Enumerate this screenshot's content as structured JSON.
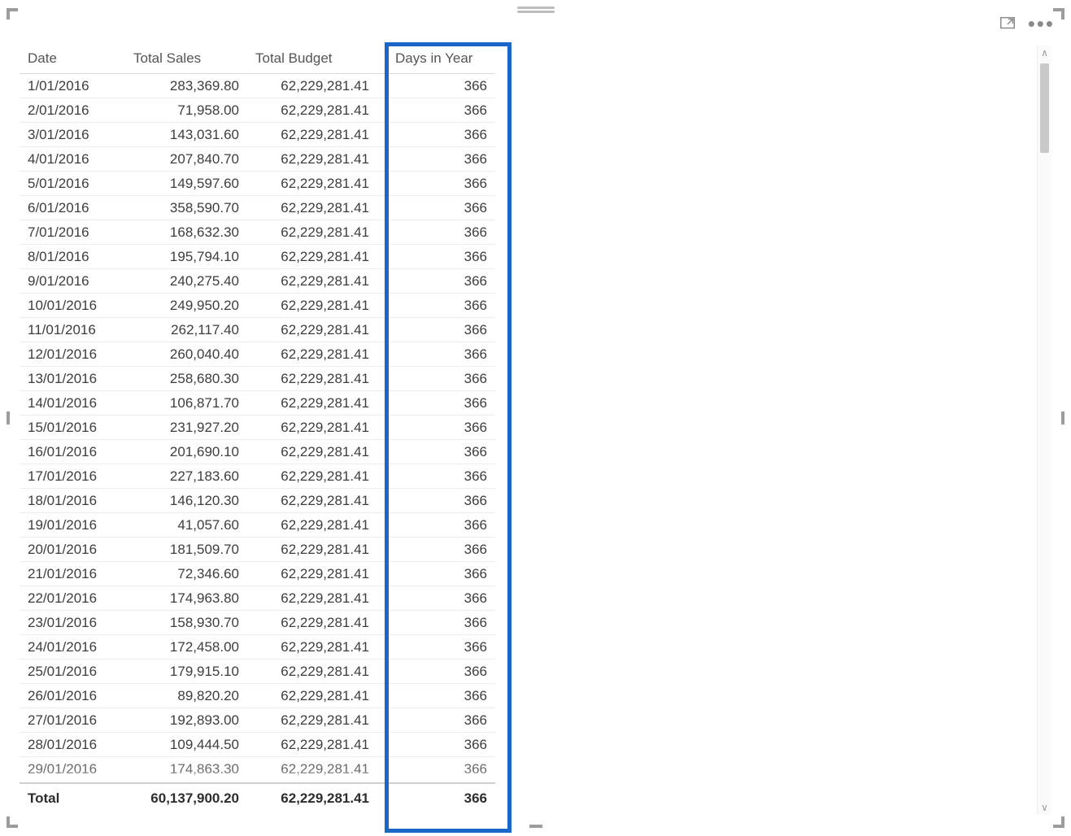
{
  "visual": {
    "focus_mode_tooltip": "Focus mode",
    "more_options_tooltip": "More options"
  },
  "table": {
    "headers": {
      "date": "Date",
      "total_sales": "Total Sales",
      "total_budget": "Total Budget",
      "days_in_year": "Days in Year"
    },
    "rows": [
      {
        "date": "1/01/2016",
        "total_sales": "283,369.80",
        "total_budget": "62,229,281.41",
        "days_in_year": "366"
      },
      {
        "date": "2/01/2016",
        "total_sales": "71,958.00",
        "total_budget": "62,229,281.41",
        "days_in_year": "366"
      },
      {
        "date": "3/01/2016",
        "total_sales": "143,031.60",
        "total_budget": "62,229,281.41",
        "days_in_year": "366"
      },
      {
        "date": "4/01/2016",
        "total_sales": "207,840.70",
        "total_budget": "62,229,281.41",
        "days_in_year": "366"
      },
      {
        "date": "5/01/2016",
        "total_sales": "149,597.60",
        "total_budget": "62,229,281.41",
        "days_in_year": "366"
      },
      {
        "date": "6/01/2016",
        "total_sales": "358,590.70",
        "total_budget": "62,229,281.41",
        "days_in_year": "366"
      },
      {
        "date": "7/01/2016",
        "total_sales": "168,632.30",
        "total_budget": "62,229,281.41",
        "days_in_year": "366"
      },
      {
        "date": "8/01/2016",
        "total_sales": "195,794.10",
        "total_budget": "62,229,281.41",
        "days_in_year": "366"
      },
      {
        "date": "9/01/2016",
        "total_sales": "240,275.40",
        "total_budget": "62,229,281.41",
        "days_in_year": "366"
      },
      {
        "date": "10/01/2016",
        "total_sales": "249,950.20",
        "total_budget": "62,229,281.41",
        "days_in_year": "366"
      },
      {
        "date": "11/01/2016",
        "total_sales": "262,117.40",
        "total_budget": "62,229,281.41",
        "days_in_year": "366"
      },
      {
        "date": "12/01/2016",
        "total_sales": "260,040.40",
        "total_budget": "62,229,281.41",
        "days_in_year": "366"
      },
      {
        "date": "13/01/2016",
        "total_sales": "258,680.30",
        "total_budget": "62,229,281.41",
        "days_in_year": "366"
      },
      {
        "date": "14/01/2016",
        "total_sales": "106,871.70",
        "total_budget": "62,229,281.41",
        "days_in_year": "366"
      },
      {
        "date": "15/01/2016",
        "total_sales": "231,927.20",
        "total_budget": "62,229,281.41",
        "days_in_year": "366"
      },
      {
        "date": "16/01/2016",
        "total_sales": "201,690.10",
        "total_budget": "62,229,281.41",
        "days_in_year": "366"
      },
      {
        "date": "17/01/2016",
        "total_sales": "227,183.60",
        "total_budget": "62,229,281.41",
        "days_in_year": "366"
      },
      {
        "date": "18/01/2016",
        "total_sales": "146,120.30",
        "total_budget": "62,229,281.41",
        "days_in_year": "366"
      },
      {
        "date": "19/01/2016",
        "total_sales": "41,057.60",
        "total_budget": "62,229,281.41",
        "days_in_year": "366"
      },
      {
        "date": "20/01/2016",
        "total_sales": "181,509.70",
        "total_budget": "62,229,281.41",
        "days_in_year": "366"
      },
      {
        "date": "21/01/2016",
        "total_sales": "72,346.60",
        "total_budget": "62,229,281.41",
        "days_in_year": "366"
      },
      {
        "date": "22/01/2016",
        "total_sales": "174,963.80",
        "total_budget": "62,229,281.41",
        "days_in_year": "366"
      },
      {
        "date": "23/01/2016",
        "total_sales": "158,930.70",
        "total_budget": "62,229,281.41",
        "days_in_year": "366"
      },
      {
        "date": "24/01/2016",
        "total_sales": "172,458.00",
        "total_budget": "62,229,281.41",
        "days_in_year": "366"
      },
      {
        "date": "25/01/2016",
        "total_sales": "179,915.10",
        "total_budget": "62,229,281.41",
        "days_in_year": "366"
      },
      {
        "date": "26/01/2016",
        "total_sales": "89,820.20",
        "total_budget": "62,229,281.41",
        "days_in_year": "366"
      },
      {
        "date": "27/01/2016",
        "total_sales": "192,893.00",
        "total_budget": "62,229,281.41",
        "days_in_year": "366"
      },
      {
        "date": "28/01/2016",
        "total_sales": "109,444.50",
        "total_budget": "62,229,281.41",
        "days_in_year": "366"
      }
    ],
    "clipped_row": {
      "date": "29/01/2016",
      "total_sales": "174,863.30",
      "total_budget": "62,229,281.41",
      "days_in_year": "366"
    },
    "total": {
      "label": "Total",
      "total_sales": "60,137,900.20",
      "total_budget": "62,229,281.41",
      "days_in_year": "366"
    }
  },
  "highlight": {
    "column": "days_in_year",
    "color": "#1a66c9"
  }
}
